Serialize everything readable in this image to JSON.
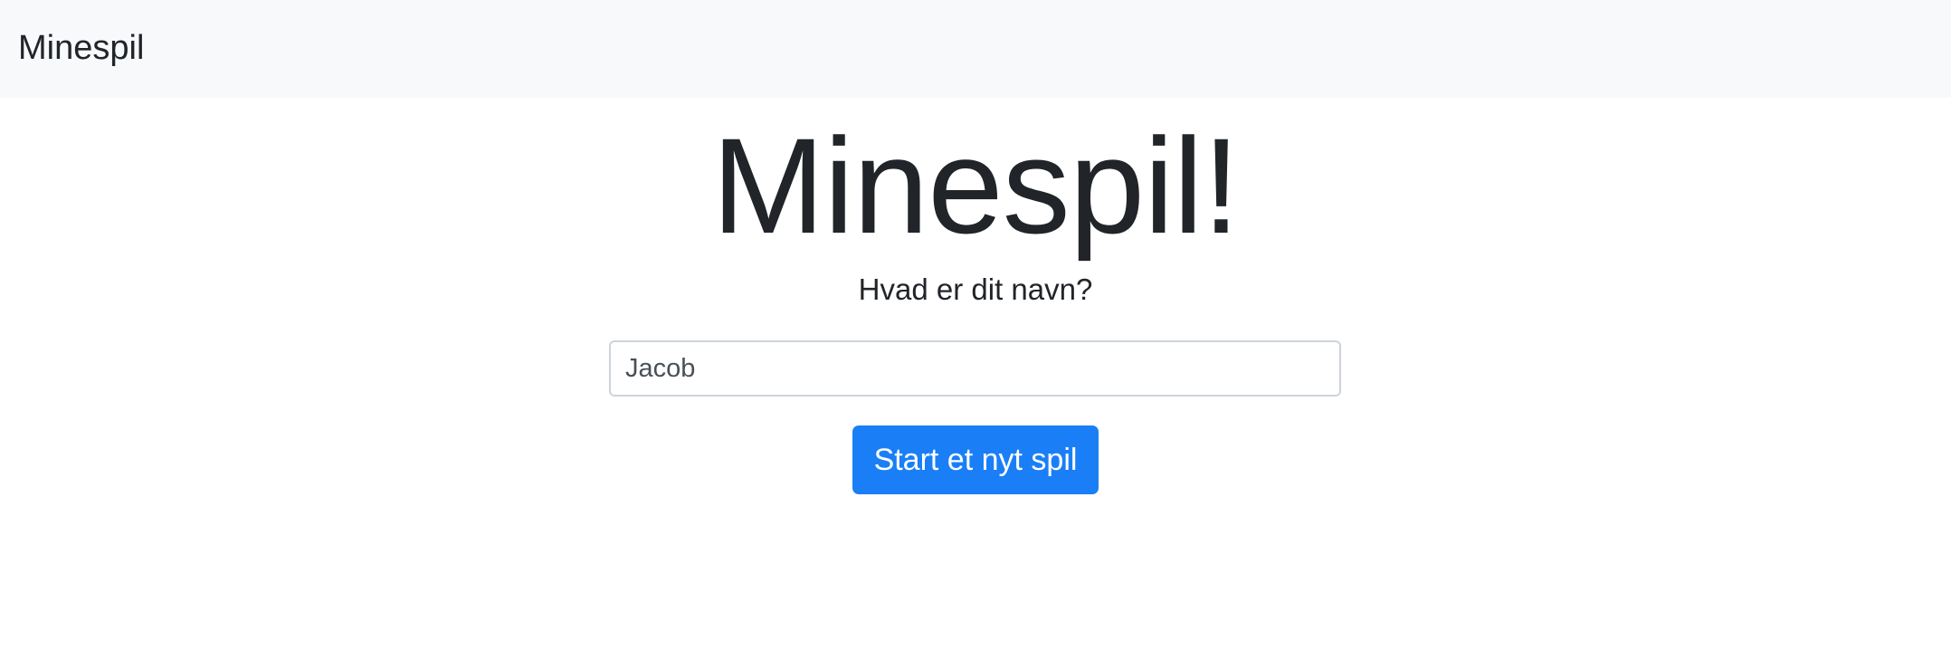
{
  "navbar": {
    "brand": "Minespil"
  },
  "main": {
    "title": "Minespil!",
    "prompt": "Hvad er dit navn?",
    "name_input": {
      "value": "Jacob"
    },
    "start_button_label": "Start et nyt spil"
  },
  "colors": {
    "navbar_bg": "#f8f9fa",
    "primary": "#1a7ff6",
    "text": "#212529"
  }
}
